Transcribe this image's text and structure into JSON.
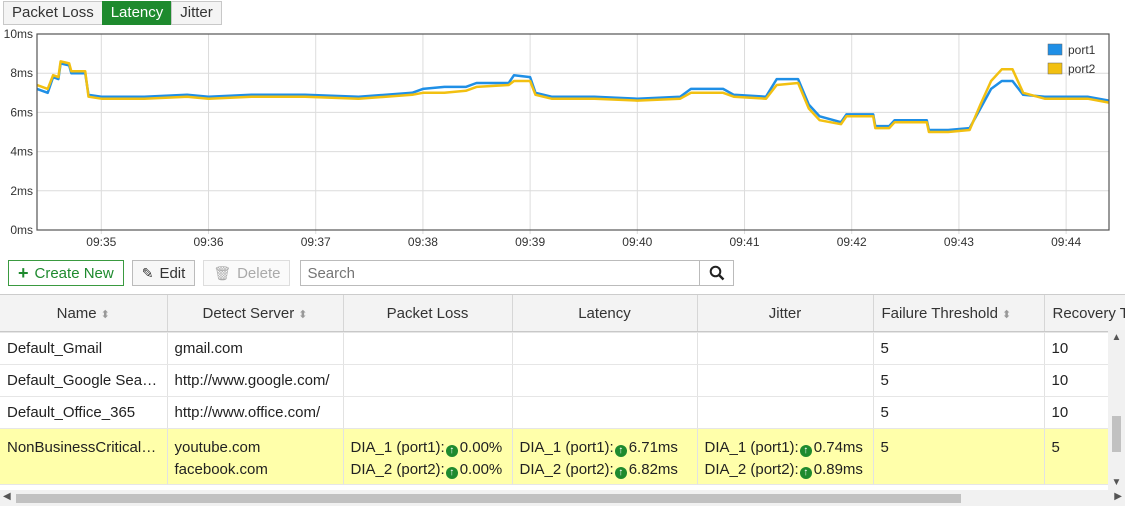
{
  "tabs": [
    {
      "label": "Packet Loss",
      "active": false
    },
    {
      "label": "Latency",
      "active": true
    },
    {
      "label": "Jitter",
      "active": false
    }
  ],
  "chart_data": {
    "type": "line",
    "title": "",
    "ylabel": "",
    "xlabel": "",
    "y_unit": "ms",
    "ylim": [
      0,
      10
    ],
    "y_ticks": [
      "0ms",
      "2ms",
      "4ms",
      "6ms",
      "8ms",
      "10ms"
    ],
    "x_ticks": [
      "09:35",
      "09:36",
      "09:37",
      "09:38",
      "09:39",
      "09:40",
      "09:41",
      "09:42",
      "09:43",
      "09:44"
    ],
    "x_tick_minutes": [
      0.6,
      1.6,
      2.6,
      3.6,
      4.6,
      5.6,
      6.6,
      7.6,
      8.6,
      9.6
    ],
    "xlim_minutes": [
      0,
      10
    ],
    "grid": true,
    "legend_position": "top-right",
    "series": [
      {
        "name": "port1",
        "color": "#1f8fe6",
        "points": [
          [
            0,
            7.2
          ],
          [
            0.1,
            7.0
          ],
          [
            0.15,
            7.8
          ],
          [
            0.2,
            7.7
          ],
          [
            0.22,
            8.5
          ],
          [
            0.3,
            8.4
          ],
          [
            0.32,
            8.0
          ],
          [
            0.45,
            8.0
          ],
          [
            0.48,
            6.9
          ],
          [
            0.6,
            6.8
          ],
          [
            1.0,
            6.8
          ],
          [
            1.4,
            6.9
          ],
          [
            1.6,
            6.8
          ],
          [
            2.0,
            6.9
          ],
          [
            2.5,
            6.9
          ],
          [
            3.0,
            6.8
          ],
          [
            3.5,
            7.0
          ],
          [
            3.6,
            7.2
          ],
          [
            3.8,
            7.3
          ],
          [
            4.0,
            7.3
          ],
          [
            4.1,
            7.5
          ],
          [
            4.4,
            7.5
          ],
          [
            4.45,
            7.9
          ],
          [
            4.6,
            7.8
          ],
          [
            4.65,
            7.0
          ],
          [
            4.8,
            6.8
          ],
          [
            5.2,
            6.8
          ],
          [
            5.6,
            6.7
          ],
          [
            6.0,
            6.8
          ],
          [
            6.1,
            7.2
          ],
          [
            6.4,
            7.2
          ],
          [
            6.5,
            6.9
          ],
          [
            6.8,
            6.8
          ],
          [
            6.9,
            7.7
          ],
          [
            7.1,
            7.7
          ],
          [
            7.2,
            6.4
          ],
          [
            7.3,
            5.8
          ],
          [
            7.5,
            5.5
          ],
          [
            7.55,
            5.9
          ],
          [
            7.8,
            5.9
          ],
          [
            7.82,
            5.3
          ],
          [
            7.95,
            5.3
          ],
          [
            8.0,
            5.6
          ],
          [
            8.3,
            5.6
          ],
          [
            8.32,
            5.1
          ],
          [
            8.5,
            5.1
          ],
          [
            8.7,
            5.2
          ],
          [
            8.8,
            6.2
          ],
          [
            8.9,
            7.2
          ],
          [
            9.0,
            7.6
          ],
          [
            9.1,
            7.6
          ],
          [
            9.2,
            6.9
          ],
          [
            9.4,
            6.8
          ],
          [
            9.6,
            6.8
          ],
          [
            9.8,
            6.8
          ],
          [
            10,
            6.6
          ]
        ]
      },
      {
        "name": "port2",
        "color": "#f2c011",
        "points": [
          [
            0,
            7.4
          ],
          [
            0.1,
            7.2
          ],
          [
            0.15,
            7.9
          ],
          [
            0.2,
            7.8
          ],
          [
            0.22,
            8.6
          ],
          [
            0.3,
            8.5
          ],
          [
            0.32,
            8.1
          ],
          [
            0.45,
            8.1
          ],
          [
            0.48,
            6.8
          ],
          [
            0.6,
            6.7
          ],
          [
            1.0,
            6.7
          ],
          [
            1.4,
            6.8
          ],
          [
            1.6,
            6.7
          ],
          [
            2.0,
            6.8
          ],
          [
            2.5,
            6.8
          ],
          [
            3.0,
            6.7
          ],
          [
            3.5,
            6.9
          ],
          [
            3.6,
            7.0
          ],
          [
            3.8,
            7.0
          ],
          [
            4.0,
            7.1
          ],
          [
            4.1,
            7.3
          ],
          [
            4.4,
            7.4
          ],
          [
            4.45,
            7.6
          ],
          [
            4.6,
            7.6
          ],
          [
            4.65,
            6.9
          ],
          [
            4.8,
            6.7
          ],
          [
            5.2,
            6.7
          ],
          [
            5.6,
            6.6
          ],
          [
            6.0,
            6.7
          ],
          [
            6.1,
            7.0
          ],
          [
            6.4,
            7.0
          ],
          [
            6.5,
            6.8
          ],
          [
            6.8,
            6.7
          ],
          [
            6.9,
            7.4
          ],
          [
            7.1,
            7.5
          ],
          [
            7.2,
            6.2
          ],
          [
            7.3,
            5.6
          ],
          [
            7.5,
            5.4
          ],
          [
            7.55,
            5.8
          ],
          [
            7.8,
            5.8
          ],
          [
            7.82,
            5.2
          ],
          [
            7.95,
            5.2
          ],
          [
            8.0,
            5.5
          ],
          [
            8.3,
            5.5
          ],
          [
            8.32,
            5.0
          ],
          [
            8.5,
            5.0
          ],
          [
            8.7,
            5.1
          ],
          [
            8.8,
            6.4
          ],
          [
            8.9,
            7.6
          ],
          [
            9.0,
            8.2
          ],
          [
            9.1,
            8.2
          ],
          [
            9.2,
            7.0
          ],
          [
            9.4,
            6.7
          ],
          [
            9.6,
            6.7
          ],
          [
            9.8,
            6.7
          ],
          [
            10,
            6.5
          ]
        ]
      }
    ]
  },
  "toolbar": {
    "create_label": "Create New",
    "edit_label": "Edit",
    "delete_label": "Delete",
    "search_placeholder": "Search"
  },
  "table": {
    "columns": [
      "Name",
      "Detect Server",
      "Packet Loss",
      "Latency",
      "Jitter",
      "Failure Threshold",
      "Recovery Threshold"
    ],
    "rows": [
      {
        "name": "Default_Gmail",
        "server": "gmail.com",
        "failure": "5",
        "recovery": "10"
      },
      {
        "name": "Default_Google Search",
        "server": "http://www.google.com/",
        "failure": "5",
        "recovery": "10"
      },
      {
        "name": "Default_Office_365",
        "server": "http://www.office.com/",
        "failure": "5",
        "recovery": "10"
      }
    ],
    "selected": {
      "name": "NonBusinessCritical_...",
      "server1": "youtube.com",
      "server2": "facebook.com",
      "pl_label1": "DIA_1 (port1):",
      "pl_value1": "0.00%",
      "pl_label2": "DIA_2 (port2):",
      "pl_value2": "0.00%",
      "lat_label1": "DIA_1 (port1):",
      "lat_value1": "6.71ms",
      "lat_label2": "DIA_2 (port2):",
      "lat_value2": "6.82ms",
      "jit_label1": "DIA_1 (port1):",
      "jit_value1": "0.74ms",
      "jit_label2": "DIA_2 (port2):",
      "jit_value2": "0.89ms",
      "failure": "5",
      "recovery": "5"
    }
  }
}
